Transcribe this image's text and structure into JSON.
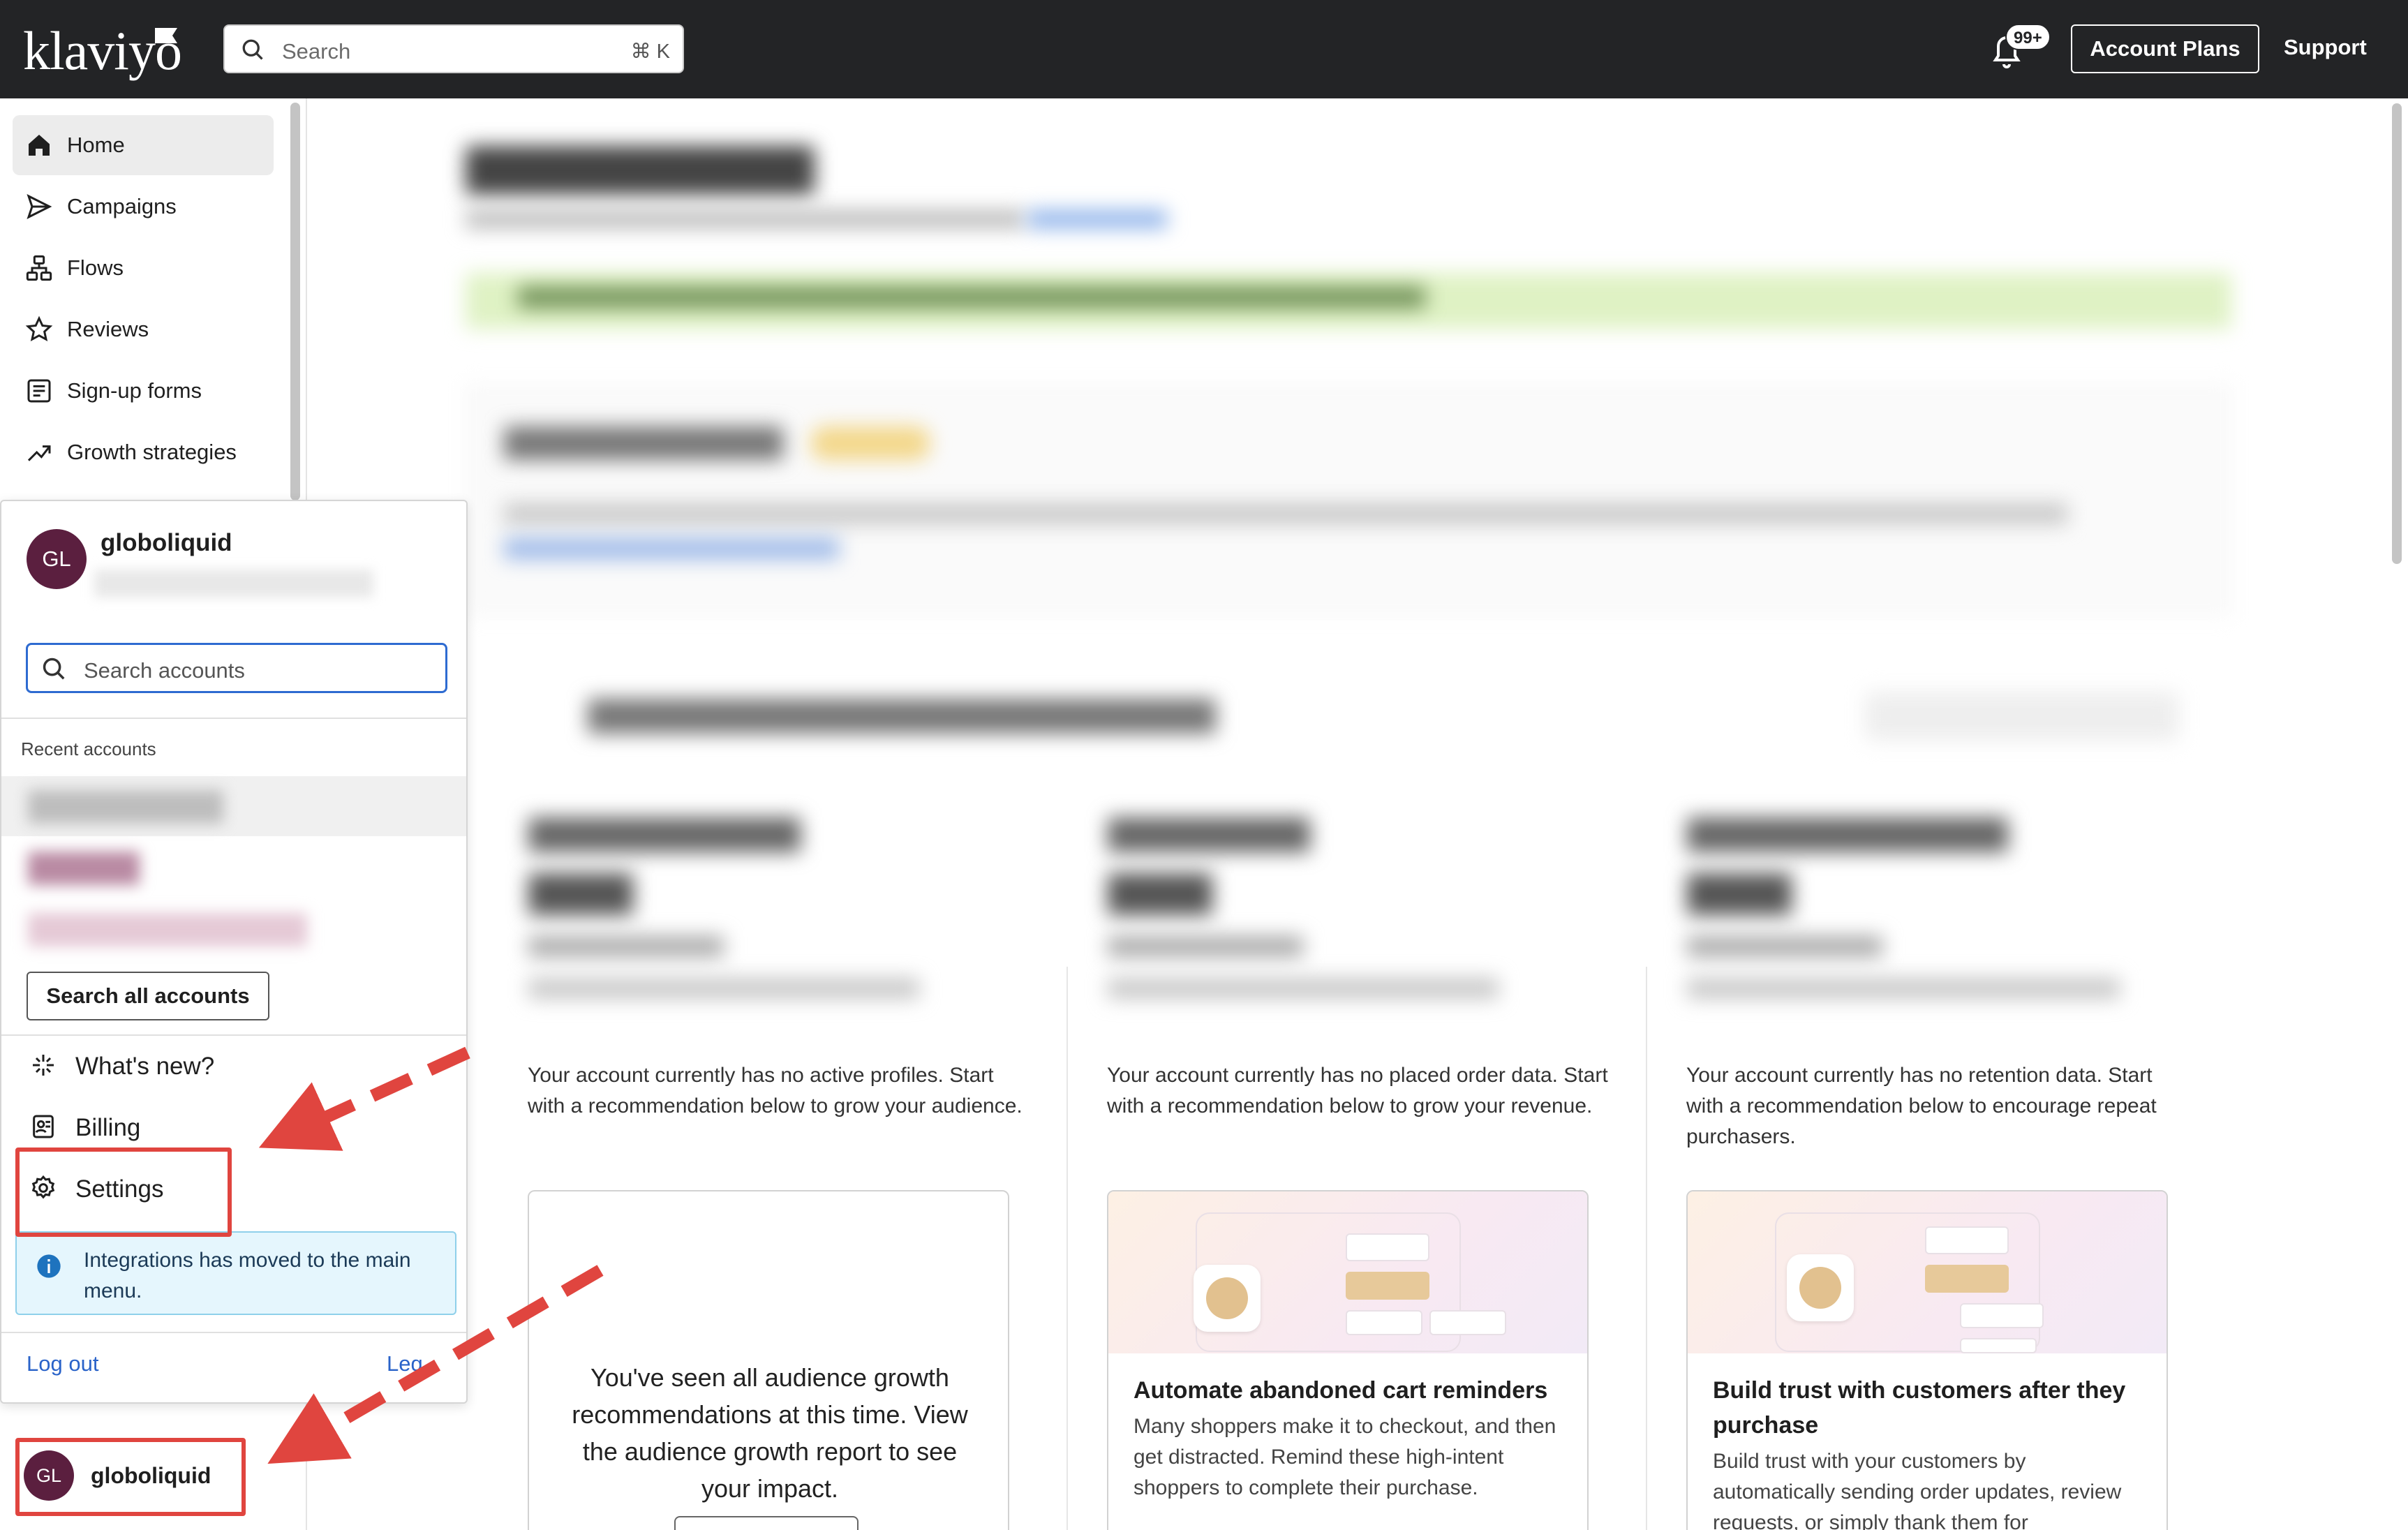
{
  "topbar": {
    "logo": "klaviyo",
    "search_placeholder": "Search",
    "search_shortcut": "⌘ K",
    "notifications_badge": "99+",
    "account_plans_label": "Account Plans",
    "support_label": "Support"
  },
  "sidebar": {
    "items": [
      {
        "label": "Home",
        "icon": "home-icon",
        "active": true
      },
      {
        "label": "Campaigns",
        "icon": "send-icon",
        "active": false
      },
      {
        "label": "Flows",
        "icon": "flows-icon",
        "active": false
      },
      {
        "label": "Reviews",
        "icon": "star-icon",
        "active": false
      },
      {
        "label": "Sign-up forms",
        "icon": "form-icon",
        "active": false
      },
      {
        "label": "Growth strategies",
        "icon": "trend-icon",
        "active": false
      }
    ]
  },
  "popover": {
    "account_initials": "GL",
    "account_name": "globoliquid",
    "search_placeholder": "Search accounts",
    "recent_label": "Recent accounts",
    "search_all_label": "Search all accounts",
    "menu": [
      {
        "label": "What's new?",
        "icon": "sparkle-icon"
      },
      {
        "label": "Billing",
        "icon": "billing-icon"
      },
      {
        "label": "Settings",
        "icon": "gear-icon"
      }
    ],
    "info_message": "Integrations has moved to the main menu.",
    "logout_label": "Log out",
    "legal_label": "Leg"
  },
  "account_chip": {
    "initials": "GL",
    "name": "globoliquid"
  },
  "dashboard": {
    "columns": [
      {
        "empty_message": "Your account currently has no active profiles. Start with a recommendation below to grow your audience.",
        "seen_message": "You've seen all audience growth recommendations at this time. View the audience growth report to see your impact."
      },
      {
        "empty_message": "Your account currently has no placed order data. Start with a recommendation below to grow your revenue.",
        "rec_title": "Automate abandoned cart reminders",
        "rec_desc": "Many shoppers make it to checkout, and then get distracted. Remind these high-intent shoppers to complete their purchase."
      },
      {
        "empty_message": "Your account currently has no retention data. Start with a recommendation below to encourage repeat purchasers.",
        "rec_title": "Build trust with customers after they purchase",
        "rec_desc": "Build trust with your customers by automatically sending order updates, review requests, or simply thank them for"
      }
    ]
  },
  "colors": {
    "topbar_bg": "#232426",
    "avatar_bg": "#5b1f3f",
    "link": "#2a63c9",
    "annotation_red": "#e0453f",
    "info_bg": "#e5f6fd"
  }
}
